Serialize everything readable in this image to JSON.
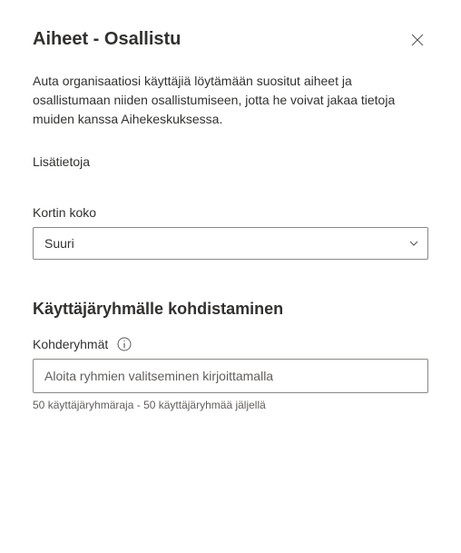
{
  "header": {
    "title": "Aiheet - Osallistu"
  },
  "description": "Auta organisaatiosi käyttäjiä löytämään suositut aiheet ja osallistumaan niiden osallistumiseen, jotta he voivat jakaa tietoja muiden kanssa Aihekeskuksessa.",
  "learnMore": "Lisätietoja",
  "cardSize": {
    "label": "Kortin koko",
    "value": "Suuri"
  },
  "targeting": {
    "sectionTitle": "Käyttäjäryhmälle kohdistaminen",
    "label": "Kohderyhmät",
    "placeholder": "Aloita ryhmien valitseminen kirjoittamalla",
    "hintPrefix": "50",
    "hintText": " käyttäjäryhmäraja - 50 käyttäjäryhmää jäljellä"
  }
}
